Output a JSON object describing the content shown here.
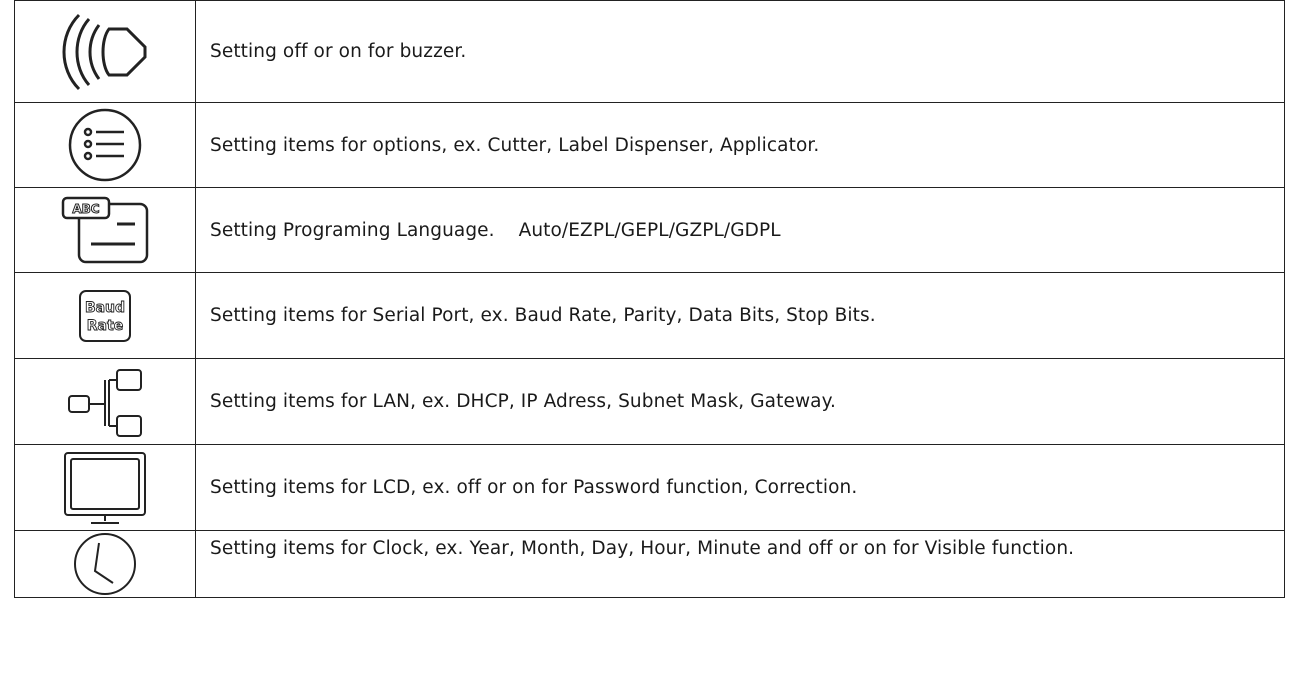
{
  "rows": [
    {
      "icon": "buzzer-icon",
      "description": "Setting off or on for buzzer."
    },
    {
      "icon": "options-list-icon",
      "description": "Setting items for options, ex. Cutter, Label Dispenser, Applicator."
    },
    {
      "icon": "language-icon",
      "icon_text": "ABC",
      "description": "Setting Programing Language.    Auto/EZPL/GEPL/GZPL/GDPL"
    },
    {
      "icon": "serial-port-icon",
      "icon_text_1": "Baud",
      "icon_text_2": "Rate",
      "description": "Setting items for Serial Port, ex. Baud Rate, Parity, Data Bits, Stop Bits."
    },
    {
      "icon": "lan-icon",
      "description": "Setting items for LAN, ex. DHCP, IP Adress, Subnet Mask, Gateway."
    },
    {
      "icon": "lcd-icon",
      "description": "Setting items for LCD, ex. off or on for Password function, Correction."
    },
    {
      "icon": "clock-icon",
      "description": "Setting items for Clock, ex. Year, Month, Day, Hour, Minute and off or on for Visible function."
    }
  ]
}
